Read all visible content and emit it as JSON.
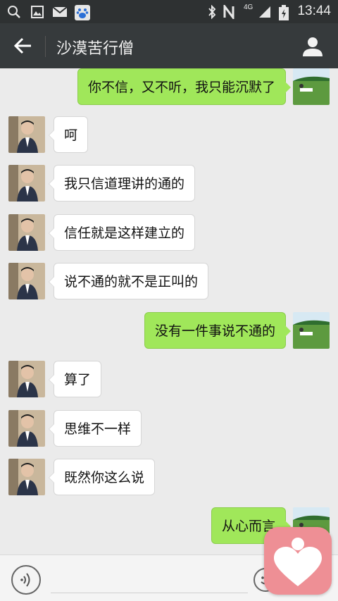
{
  "status_bar": {
    "time": "13:44",
    "network": "4G",
    "icons": [
      "search-icon",
      "gallery-icon",
      "mail-icon",
      "baidu-paw-icon",
      "bluetooth-icon",
      "nfc-icon",
      "signal-icon",
      "battery-icon"
    ]
  },
  "header": {
    "title": "沙漠苦行僧",
    "back_icon": "arrow-left-icon",
    "contact_icon": "person-icon"
  },
  "messages": [
    {
      "side": "right",
      "text": "你不信，又不听，我只能沉默了"
    },
    {
      "side": "left",
      "text": "呵"
    },
    {
      "side": "left",
      "text": "我只信道理讲的通的"
    },
    {
      "side": "left",
      "text": "信任就是这样建立的"
    },
    {
      "side": "left",
      "text": "说不通的就不是正叫的"
    },
    {
      "side": "right",
      "text": "没有一件事说不通的"
    },
    {
      "side": "left",
      "text": "算了"
    },
    {
      "side": "left",
      "text": "思维不一样"
    },
    {
      "side": "left",
      "text": "既然你这么说"
    },
    {
      "side": "right",
      "text": "从心而言"
    }
  ],
  "input_bar": {
    "voice_icon": "voice-icon",
    "emoji_icon": "emoji-icon",
    "input_value": ""
  },
  "overlay": {
    "icon": "heart-app-icon",
    "color": "#ee8f95"
  },
  "colors": {
    "header_bg": "#363a3c",
    "statusbar_bg": "#2e3132",
    "chat_bg": "#ebebeb",
    "bubble_sent": "#a0e75a",
    "bubble_received": "#ffffff"
  }
}
